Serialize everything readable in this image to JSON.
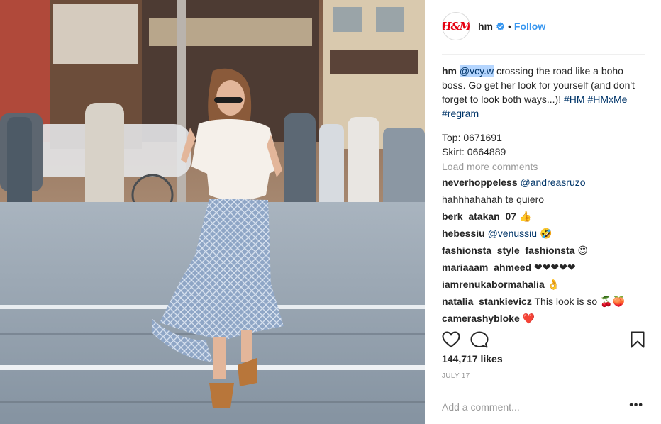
{
  "post": {
    "brand_logo_text": "H&M",
    "username": "hm",
    "verified_icon": "verified-badge-icon",
    "separator": "•",
    "follow_label": "Follow"
  },
  "caption": {
    "user": "hm",
    "mention": "@vcy.w",
    "text_1": " crossing the road like a boho",
    "line_2": "boss. Go get her look for yourself (and don't",
    "line_3a": "forget to look both ways...)! ",
    "tag_1": "#HM",
    "tag_2": "#HMxMe",
    "tag_3": "#regram",
    "top": "Top: 0671691",
    "skirt": "Skirt: 0664889"
  },
  "load_more_label": "Load more comments",
  "comments": [
    {
      "user": "neverhoppeless",
      "mention": "@andreasruzo",
      "text": "",
      "emoji": ""
    },
    {
      "user": "",
      "mention": "",
      "text": "hahhhahahah te quiero",
      "emoji": ""
    },
    {
      "user": "berk_atakan_07",
      "mention": "",
      "text": "",
      "emoji": "👍"
    },
    {
      "user": "hebessiu",
      "mention": "@venussiu",
      "text": "",
      "emoji": "🤣"
    },
    {
      "user": "fashionsta_style_fashionsta",
      "mention": "",
      "text": "",
      "emoji": "😍"
    },
    {
      "user": "mariaaam_ahmeed",
      "mention": "",
      "text": "",
      "emoji": "❤❤❤❤❤"
    },
    {
      "user": "iamrenukabormahalia",
      "mention": "",
      "text": "",
      "emoji": "👌"
    },
    {
      "user": "natalia_stankievicz",
      "mention": "",
      "text": "This look is so",
      "emoji": "🍒🍑"
    },
    {
      "user": "camerashybloke",
      "mention": "",
      "text": "",
      "emoji": "❤️"
    }
  ],
  "actions": {
    "like_icon": "heart-icon",
    "comment_icon": "comment-bubble-icon",
    "save_icon": "bookmark-icon"
  },
  "likes_text": "144,717 likes",
  "date_text": "JULY 17",
  "add_comment_placeholder": "Add a comment...",
  "more_options": "•••",
  "colors": {
    "link": "#003569",
    "follow": "#3897f0",
    "muted": "#999999",
    "brand_red": "#e50010"
  }
}
